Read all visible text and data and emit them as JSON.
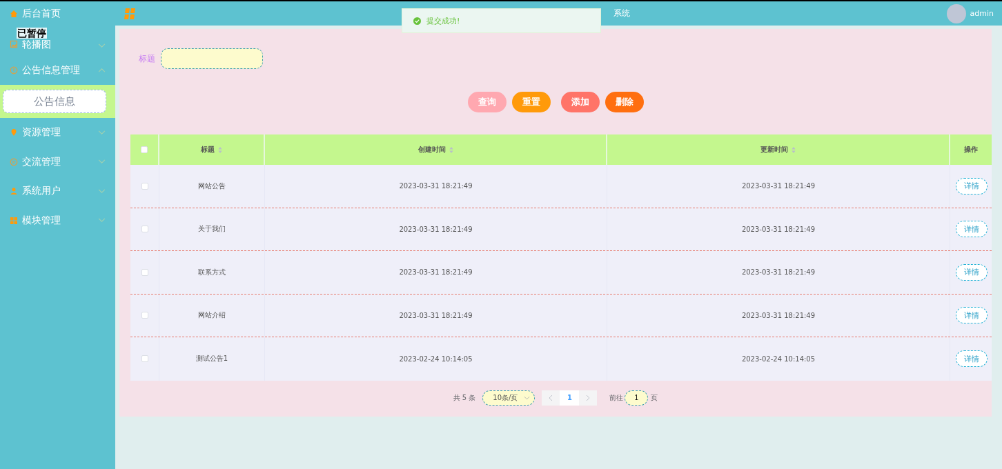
{
  "header": {
    "title": "系统",
    "user": "admin"
  },
  "toast": {
    "kind": "success",
    "text": "提交成功!"
  },
  "player_overlay": {
    "text": "已暂停"
  },
  "sidebar": {
    "items": [
      {
        "label": "后台首页"
      },
      {
        "label": "轮播图",
        "expanded": false
      },
      {
        "label": "公告信息管理",
        "expanded": true,
        "children": [
          {
            "label": "公告信息",
            "selected": true
          }
        ]
      },
      {
        "label": "资源管理",
        "expanded": false
      },
      {
        "label": "交流管理",
        "expanded": false
      },
      {
        "label": "系统用户",
        "expanded": false
      },
      {
        "label": "模块管理",
        "expanded": false
      }
    ]
  },
  "search": {
    "label": "标题"
  },
  "buttons": [
    {
      "label": "查询",
      "color": "#ffa8b0"
    },
    {
      "label": "重置",
      "color": "#ff9a0a"
    },
    {
      "label": "添加",
      "color": "#ff7468"
    },
    {
      "label": "删除",
      "color": "#ff6f0f"
    }
  ],
  "table": {
    "select_all": {
      "checked": false
    },
    "columns": [
      {
        "label": "标题",
        "sortable": true
      },
      {
        "label": "创建时间",
        "sortable": true
      },
      {
        "label": "更新时间",
        "sortable": true
      },
      {
        "label": "操作",
        "sortable": false
      }
    ],
    "rows": [
      {
        "checked": false,
        "title": "网站公告",
        "created": "2023-03-31 18:21:49",
        "updated": "2023-03-31 18:21:49",
        "action": "详情"
      },
      {
        "checked": false,
        "title": "关于我们",
        "created": "2023-03-31 18:21:49",
        "updated": "2023-03-31 18:21:49",
        "action": "详情"
      },
      {
        "checked": false,
        "title": "联系方式",
        "created": "2023-03-31 18:21:49",
        "updated": "2023-03-31 18:21:49",
        "action": "详情"
      },
      {
        "checked": false,
        "title": "网站介绍",
        "created": "2023-03-31 18:21:49",
        "updated": "2023-03-31 18:21:49",
        "action": "详情"
      },
      {
        "checked": false,
        "title": "测试公告1",
        "created": "2023-02-24 10:14:05",
        "updated": "2023-02-24 10:14:05",
        "action": "详情"
      }
    ]
  },
  "pagination": {
    "total": "共 5 条",
    "page_size": "10条/页",
    "pages": [
      {
        "label": "1",
        "selected": true
      }
    ],
    "goto_label": "前往",
    "goto_value": "1",
    "page_unit": "页"
  }
}
